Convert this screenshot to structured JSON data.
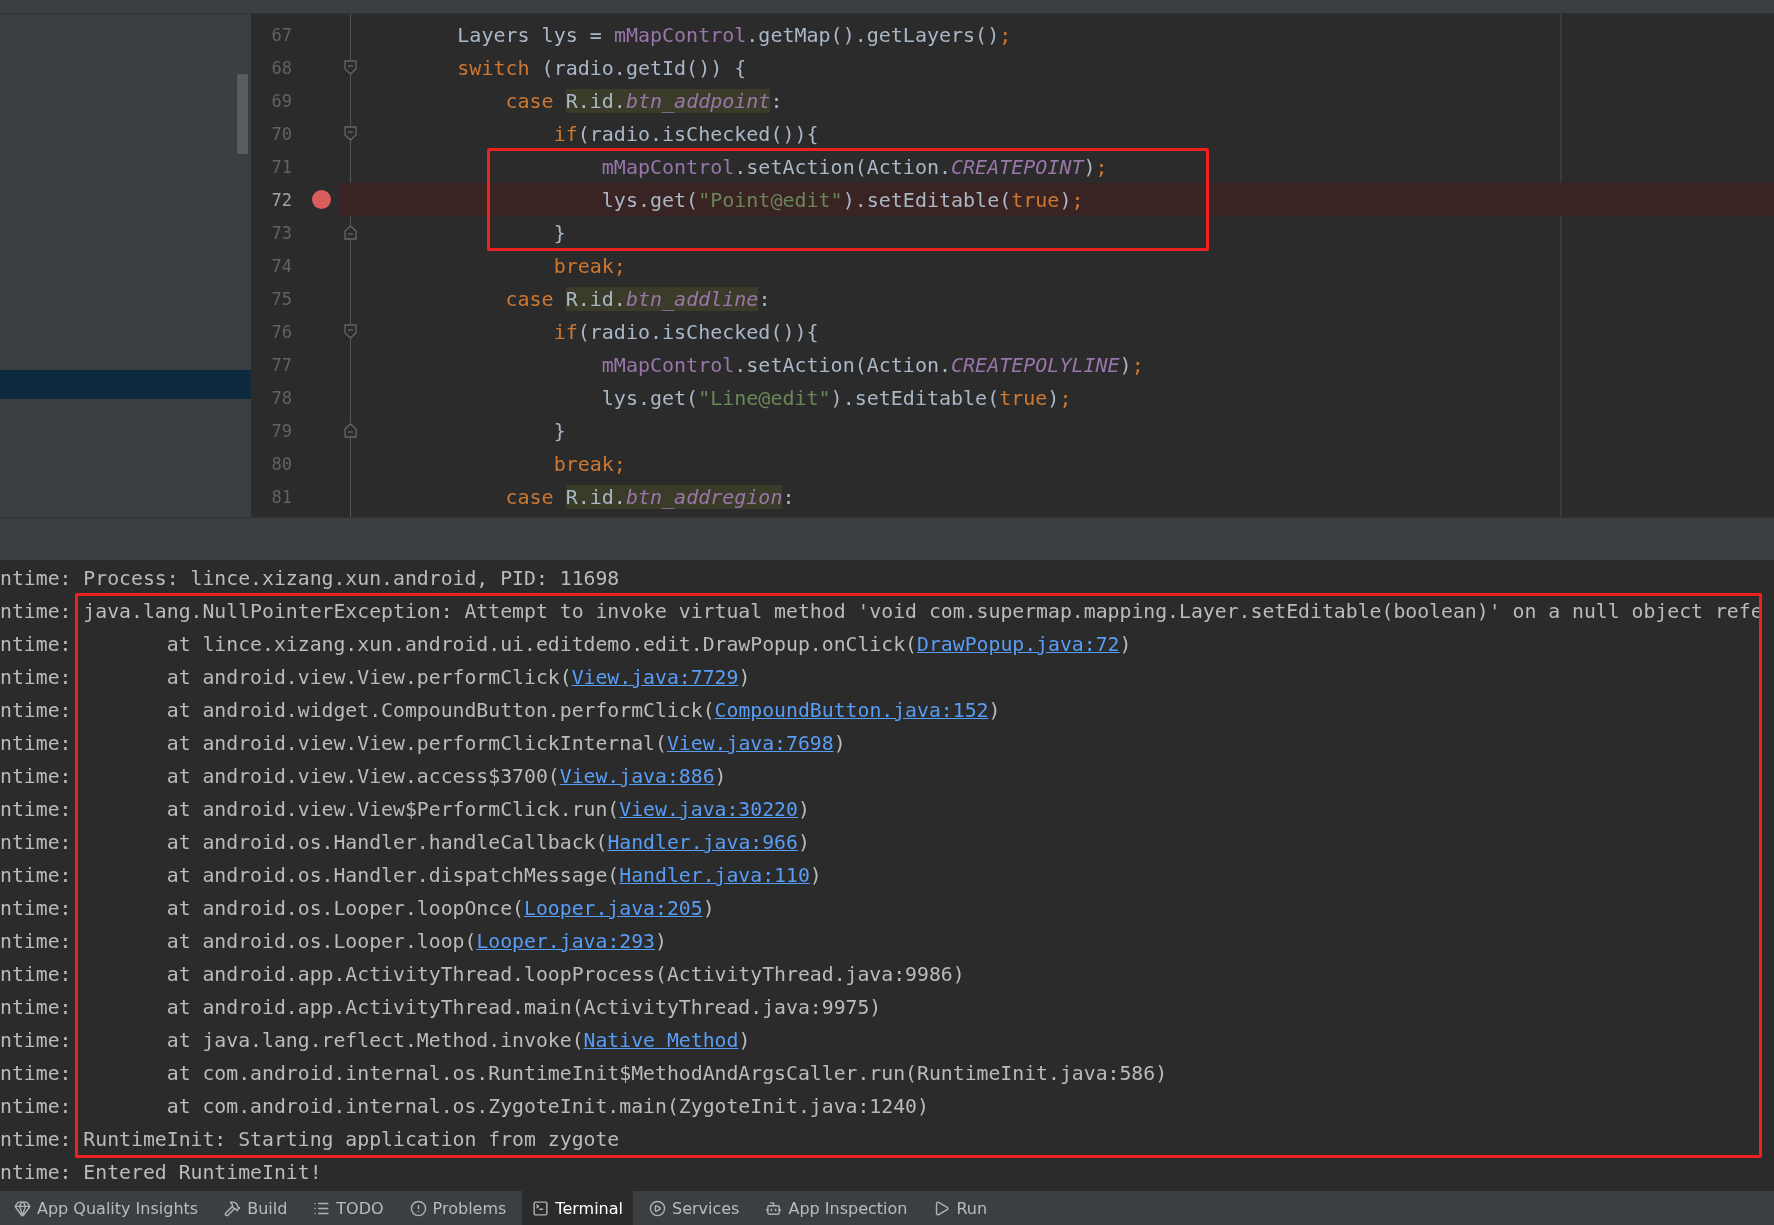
{
  "code_editor": {
    "sections": [
      {
        "framed": false,
        "lines": [
          {
            "number": "67",
            "breakpoint": false,
            "kind": "plain",
            "tokens": [
              {
                "text": "        Layers lys = ",
                "kind": "plain"
              },
              {
                "text": "mMapControl",
                "kind": "field"
              },
              {
                "text": ".getMap().getLayers()",
                "kind": "plain"
              },
              {
                "text": ";",
                "kind": "keyword"
              }
            ]
          },
          {
            "number": "68",
            "breakpoint": false,
            "kind": "fold-start",
            "tokens": [
              {
                "text": "        switch",
                "kind": "keyword"
              },
              {
                "text": " (radio.getId()) {",
                "kind": "plain"
              }
            ]
          },
          {
            "number": "69",
            "breakpoint": false,
            "kind": "plain",
            "tokens": [
              {
                "text": "            case ",
                "kind": "keyword"
              },
              {
                "text": "R.id.",
                "kind": "ref"
              },
              {
                "text": "btn_addpoint",
                "kind": "ref-constant"
              },
              {
                "text": ":",
                "kind": "plain"
              }
            ]
          },
          {
            "number": "70",
            "breakpoint": false,
            "kind": "fold-start",
            "tokens": [
              {
                "text": "                if",
                "kind": "keyword"
              },
              {
                "text": "(radio.isChecked()){",
                "kind": "plain"
              }
            ]
          }
        ]
      },
      {
        "framed": true,
        "lines": [
          {
            "number": "71",
            "breakpoint": false,
            "kind": "plain",
            "tokens": [
              {
                "text": "                    mMapControl",
                "kind": "field"
              },
              {
                "text": ".setAction(Action.",
                "kind": "plain"
              },
              {
                "text": "CREATEPOINT",
                "kind": "constant"
              },
              {
                "text": ")",
                "kind": "plain"
              },
              {
                "text": ";",
                "kind": "keyword"
              }
            ]
          },
          {
            "number": "72",
            "breakpoint": true,
            "kind": "plain",
            "tokens": [
              {
                "text": "                    lys.get(",
                "kind": "plain"
              },
              {
                "text": "\"Point@edit\"",
                "kind": "string"
              },
              {
                "text": ").setEditable(",
                "kind": "plain"
              },
              {
                "text": "true",
                "kind": "keyword"
              },
              {
                "text": ")",
                "kind": "plain"
              },
              {
                "text": ";",
                "kind": "keyword"
              }
            ]
          },
          {
            "number": "73",
            "breakpoint": false,
            "kind": "fold-end",
            "tokens": [
              {
                "text": "                }",
                "kind": "plain"
              }
            ]
          }
        ]
      },
      {
        "framed": false,
        "lines": [
          {
            "number": "74",
            "breakpoint": false,
            "kind": "plain",
            "tokens": [
              {
                "text": "                break;",
                "kind": "keyword"
              }
            ]
          },
          {
            "number": "75",
            "breakpoint": false,
            "kind": "plain",
            "tokens": [
              {
                "text": "            case ",
                "kind": "keyword"
              },
              {
                "text": "R.id.",
                "kind": "ref"
              },
              {
                "text": "btn_addline",
                "kind": "ref-constant"
              },
              {
                "text": ":",
                "kind": "plain"
              }
            ]
          },
          {
            "number": "76",
            "breakpoint": false,
            "kind": "fold-start",
            "tokens": [
              {
                "text": "                if",
                "kind": "keyword"
              },
              {
                "text": "(radio.isChecked()){",
                "kind": "plain"
              }
            ]
          },
          {
            "number": "77",
            "breakpoint": false,
            "kind": "plain",
            "tokens": [
              {
                "text": "                    mMapControl",
                "kind": "field"
              },
              {
                "text": ".setAction(Action.",
                "kind": "plain"
              },
              {
                "text": "CREATEPOLYLINE",
                "kind": "constant"
              },
              {
                "text": ")",
                "kind": "plain"
              },
              {
                "text": ";",
                "kind": "keyword"
              }
            ]
          },
          {
            "number": "78",
            "breakpoint": false,
            "kind": "plain",
            "tokens": [
              {
                "text": "                    lys.get(",
                "kind": "plain"
              },
              {
                "text": "\"Line@edit\"",
                "kind": "string"
              },
              {
                "text": ").setEditable(",
                "kind": "plain"
              },
              {
                "text": "true",
                "kind": "keyword"
              },
              {
                "text": ")",
                "kind": "plain"
              },
              {
                "text": ";",
                "kind": "keyword"
              }
            ]
          },
          {
            "number": "79",
            "breakpoint": false,
            "kind": "fold-end",
            "tokens": [
              {
                "text": "                }",
                "kind": "plain"
              }
            ]
          },
          {
            "number": "80",
            "breakpoint": false,
            "kind": "plain",
            "tokens": [
              {
                "text": "                break;",
                "kind": "keyword"
              }
            ]
          },
          {
            "number": "81",
            "breakpoint": false,
            "kind": "plain",
            "tokens": [
              {
                "text": "            case ",
                "kind": "keyword"
              },
              {
                "text": "R.id.",
                "kind": "ref"
              },
              {
                "text": "btn_addregion",
                "kind": "ref-constant"
              },
              {
                "text": ":",
                "kind": "plain"
              }
            ]
          }
        ]
      }
    ]
  },
  "log": {
    "sections": [
      {
        "framed": false,
        "lines": [
          {
            "tag": "ntime:",
            "kind": "message",
            "parts": [
              {
                "text": "Process: lince.xizang.xun.android, PID: 11698",
                "kind": "plain"
              }
            ]
          }
        ]
      },
      {
        "framed": true,
        "lines": [
          {
            "tag": "ntime:",
            "kind": "message",
            "parts": [
              {
                "text": "java.lang.NullPointerException: Attempt to invoke virtual method 'void com.supermap.mapping.Layer.setEditable(boolean)' on a null object refe",
                "kind": "plain"
              }
            ]
          },
          {
            "tag": "ntime:",
            "kind": "frame",
            "parts": [
              {
                "text": "at lince.xizang.xun.android.ui.editdemo.edit.DrawPopup.onClick(",
                "kind": "plain"
              },
              {
                "text": "DrawPopup.java:72",
                "kind": "link"
              },
              {
                "text": ")",
                "kind": "plain"
              }
            ]
          },
          {
            "tag": "ntime:",
            "kind": "frame",
            "parts": [
              {
                "text": "at android.view.View.performClick(",
                "kind": "plain"
              },
              {
                "text": "View.java:7729",
                "kind": "link"
              },
              {
                "text": ")",
                "kind": "plain"
              }
            ]
          },
          {
            "tag": "ntime:",
            "kind": "frame",
            "parts": [
              {
                "text": "at android.widget.CompoundButton.performClick(",
                "kind": "plain"
              },
              {
                "text": "CompoundButton.java:152",
                "kind": "link"
              },
              {
                "text": ")",
                "kind": "plain"
              }
            ]
          },
          {
            "tag": "ntime:",
            "kind": "frame",
            "parts": [
              {
                "text": "at android.view.View.performClickInternal(",
                "kind": "plain"
              },
              {
                "text": "View.java:7698",
                "kind": "link"
              },
              {
                "text": ")",
                "kind": "plain"
              }
            ]
          },
          {
            "tag": "ntime:",
            "kind": "frame",
            "parts": [
              {
                "text": "at android.view.View.access$3700(",
                "kind": "plain"
              },
              {
                "text": "View.java:886",
                "kind": "link"
              },
              {
                "text": ")",
                "kind": "plain"
              }
            ]
          },
          {
            "tag": "ntime:",
            "kind": "frame",
            "parts": [
              {
                "text": "at android.view.View$PerformClick.run(",
                "kind": "plain"
              },
              {
                "text": "View.java:30220",
                "kind": "link"
              },
              {
                "text": ")",
                "kind": "plain"
              }
            ]
          },
          {
            "tag": "ntime:",
            "kind": "frame",
            "parts": [
              {
                "text": "at android.os.Handler.handleCallback(",
                "kind": "plain"
              },
              {
                "text": "Handler.java:966",
                "kind": "link"
              },
              {
                "text": ")",
                "kind": "plain"
              }
            ]
          },
          {
            "tag": "ntime:",
            "kind": "frame",
            "parts": [
              {
                "text": "at android.os.Handler.dispatchMessage(",
                "kind": "plain"
              },
              {
                "text": "Handler.java:110",
                "kind": "link"
              },
              {
                "text": ")",
                "kind": "plain"
              }
            ]
          },
          {
            "tag": "ntime:",
            "kind": "frame",
            "parts": [
              {
                "text": "at android.os.Looper.loopOnce(",
                "kind": "plain"
              },
              {
                "text": "Looper.java:205",
                "kind": "link"
              },
              {
                "text": ")",
                "kind": "plain"
              }
            ]
          },
          {
            "tag": "ntime:",
            "kind": "frame",
            "parts": [
              {
                "text": "at android.os.Looper.loop(",
                "kind": "plain"
              },
              {
                "text": "Looper.java:293",
                "kind": "link"
              },
              {
                "text": ")",
                "kind": "plain"
              }
            ]
          },
          {
            "tag": "ntime:",
            "kind": "frame",
            "parts": [
              {
                "text": "at android.app.ActivityThread.loopProcess(ActivityThread.java:9986)",
                "kind": "plain"
              }
            ]
          },
          {
            "tag": "ntime:",
            "kind": "frame",
            "parts": [
              {
                "text": "at android.app.ActivityThread.main(ActivityThread.java:9975)",
                "kind": "plain"
              }
            ]
          },
          {
            "tag": "ntime:",
            "kind": "frame",
            "parts": [
              {
                "text": "at java.lang.reflect.Method.invoke(",
                "kind": "plain"
              },
              {
                "text": "Native Method",
                "kind": "link"
              },
              {
                "text": ")",
                "kind": "plain"
              }
            ]
          },
          {
            "tag": "ntime:",
            "kind": "frame",
            "parts": [
              {
                "text": "at com.android.internal.os.RuntimeInit$MethodAndArgsCaller.run(RuntimeInit.java:586)",
                "kind": "plain"
              }
            ]
          },
          {
            "tag": "ntime:",
            "kind": "frame",
            "parts": [
              {
                "text": "at com.android.internal.os.ZygoteInit.main(ZygoteInit.java:1240)",
                "kind": "plain"
              }
            ]
          },
          {
            "tag": "ntime:",
            "kind": "message",
            "parts": [
              {
                "text": "RuntimeInit: Starting application from zygote",
                "kind": "plain"
              }
            ]
          }
        ]
      },
      {
        "framed": false,
        "lines": [
          {
            "tag": "ntime:",
            "kind": "message",
            "parts": [
              {
                "text": "Entered RuntimeInit!",
                "kind": "plain"
              }
            ]
          }
        ]
      }
    ]
  },
  "tool_windows": [
    {
      "label": "App Quality Insights",
      "selected": false
    },
    {
      "label": "Build",
      "selected": false
    },
    {
      "label": "TODO",
      "selected": false
    },
    {
      "label": "Problems",
      "selected": false
    },
    {
      "label": "Terminal",
      "selected": true
    },
    {
      "label": "Services",
      "selected": false
    },
    {
      "label": "App Inspection",
      "selected": false
    },
    {
      "label": "Run",
      "selected": false
    }
  ]
}
